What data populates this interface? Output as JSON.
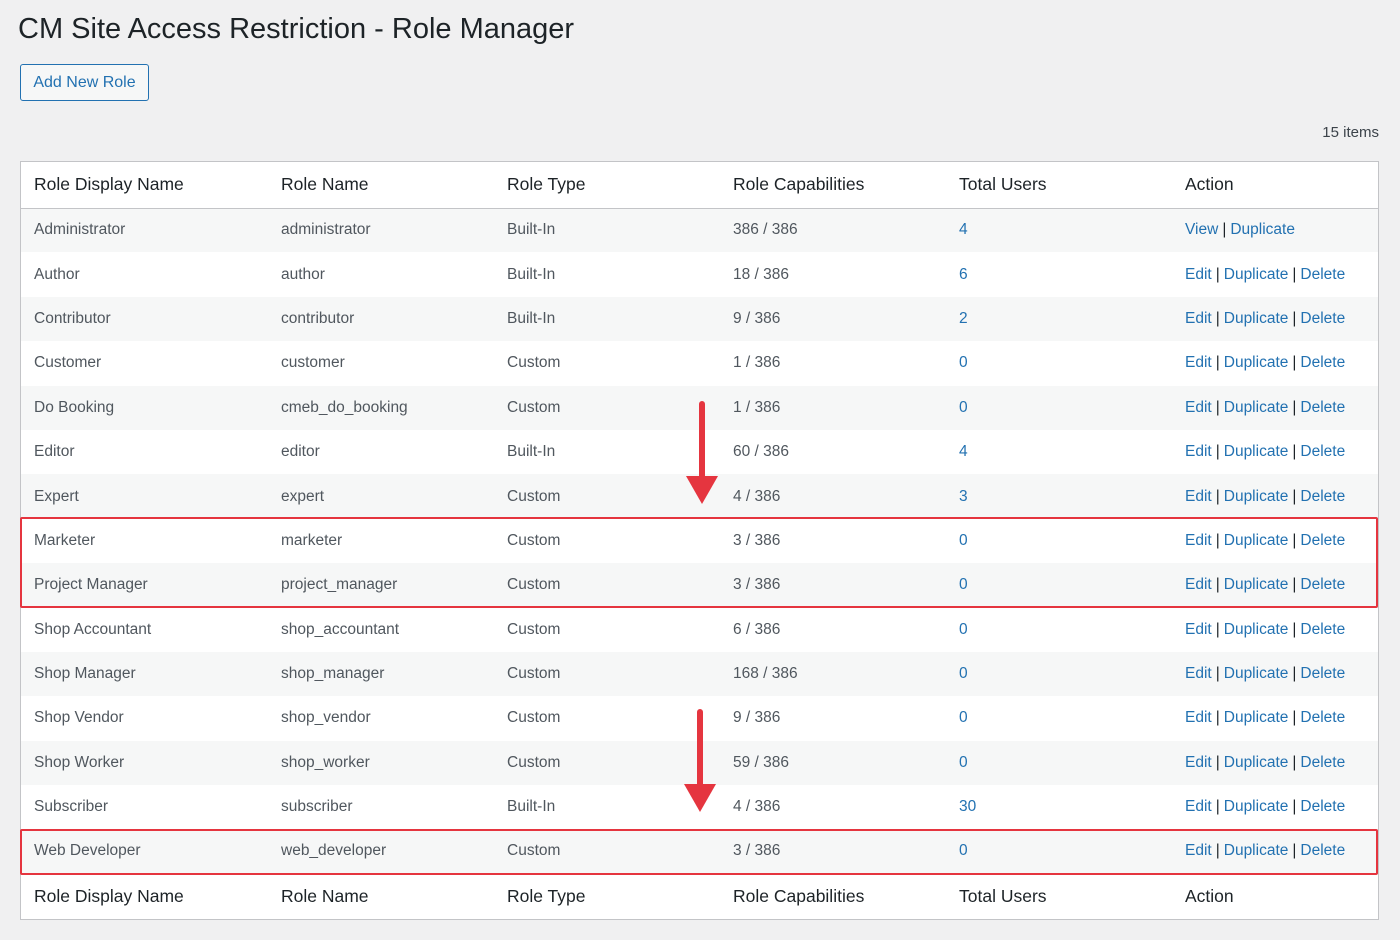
{
  "header": {
    "title": "CM Site Access Restriction - Role Manager"
  },
  "toolbar": {
    "add_label": "Add New Role",
    "items_count": "15 items"
  },
  "columns": [
    "Role Display Name",
    "Role Name",
    "Role Type",
    "Role Capabilities",
    "Total Users",
    "Action"
  ],
  "action_labels": {
    "view": "View",
    "edit": "Edit",
    "duplicate": "Duplicate",
    "delete": "Delete",
    "separator": "|"
  },
  "rows": [
    {
      "display": "Administrator",
      "name": "administrator",
      "type": "Built-In",
      "caps": "386 / 386",
      "users": "4",
      "actions": [
        "View",
        "Duplicate"
      ]
    },
    {
      "display": "Author",
      "name": "author",
      "type": "Built-In",
      "caps": "18 / 386",
      "users": "6",
      "actions": [
        "Edit",
        "Duplicate",
        "Delete"
      ]
    },
    {
      "display": "Contributor",
      "name": "contributor",
      "type": "Built-In",
      "caps": "9 / 386",
      "users": "2",
      "actions": [
        "Edit",
        "Duplicate",
        "Delete"
      ]
    },
    {
      "display": "Customer",
      "name": "customer",
      "type": "Custom",
      "caps": "1 / 386",
      "users": "0",
      "actions": [
        "Edit",
        "Duplicate",
        "Delete"
      ]
    },
    {
      "display": "Do Booking",
      "name": "cmeb_do_booking",
      "type": "Custom",
      "caps": "1 / 386",
      "users": "0",
      "actions": [
        "Edit",
        "Duplicate",
        "Delete"
      ]
    },
    {
      "display": "Editor",
      "name": "editor",
      "type": "Built-In",
      "caps": "60 / 386",
      "users": "4",
      "actions": [
        "Edit",
        "Duplicate",
        "Delete"
      ]
    },
    {
      "display": "Expert",
      "name": "expert",
      "type": "Custom",
      "caps": "4 / 386",
      "users": "3",
      "actions": [
        "Edit",
        "Duplicate",
        "Delete"
      ]
    },
    {
      "display": "Marketer",
      "name": "marketer",
      "type": "Custom",
      "caps": "3 / 386",
      "users": "0",
      "actions": [
        "Edit",
        "Duplicate",
        "Delete"
      ]
    },
    {
      "display": "Project Manager",
      "name": "project_manager",
      "type": "Custom",
      "caps": "3 / 386",
      "users": "0",
      "actions": [
        "Edit",
        "Duplicate",
        "Delete"
      ]
    },
    {
      "display": "Shop Accountant",
      "name": "shop_accountant",
      "type": "Custom",
      "caps": "6 / 386",
      "users": "0",
      "actions": [
        "Edit",
        "Duplicate",
        "Delete"
      ]
    },
    {
      "display": "Shop Manager",
      "name": "shop_manager",
      "type": "Custom",
      "caps": "168 / 386",
      "users": "0",
      "actions": [
        "Edit",
        "Duplicate",
        "Delete"
      ]
    },
    {
      "display": "Shop Vendor",
      "name": "shop_vendor",
      "type": "Custom",
      "caps": "9 / 386",
      "users": "0",
      "actions": [
        "Edit",
        "Duplicate",
        "Delete"
      ]
    },
    {
      "display": "Shop Worker",
      "name": "shop_worker",
      "type": "Custom",
      "caps": "59 / 386",
      "users": "0",
      "actions": [
        "Edit",
        "Duplicate",
        "Delete"
      ]
    },
    {
      "display": "Subscriber",
      "name": "subscriber",
      "type": "Built-In",
      "caps": "4 / 386",
      "users": "30",
      "actions": [
        "Edit",
        "Duplicate",
        "Delete"
      ]
    },
    {
      "display": "Web Developer",
      "name": "web_developer",
      "type": "Custom",
      "caps": "3 / 386",
      "users": "0",
      "actions": [
        "Edit",
        "Duplicate",
        "Delete"
      ]
    }
  ],
  "colors": {
    "link": "#2271b1",
    "highlight": "#e5353f",
    "background": "#f0f0f1"
  }
}
